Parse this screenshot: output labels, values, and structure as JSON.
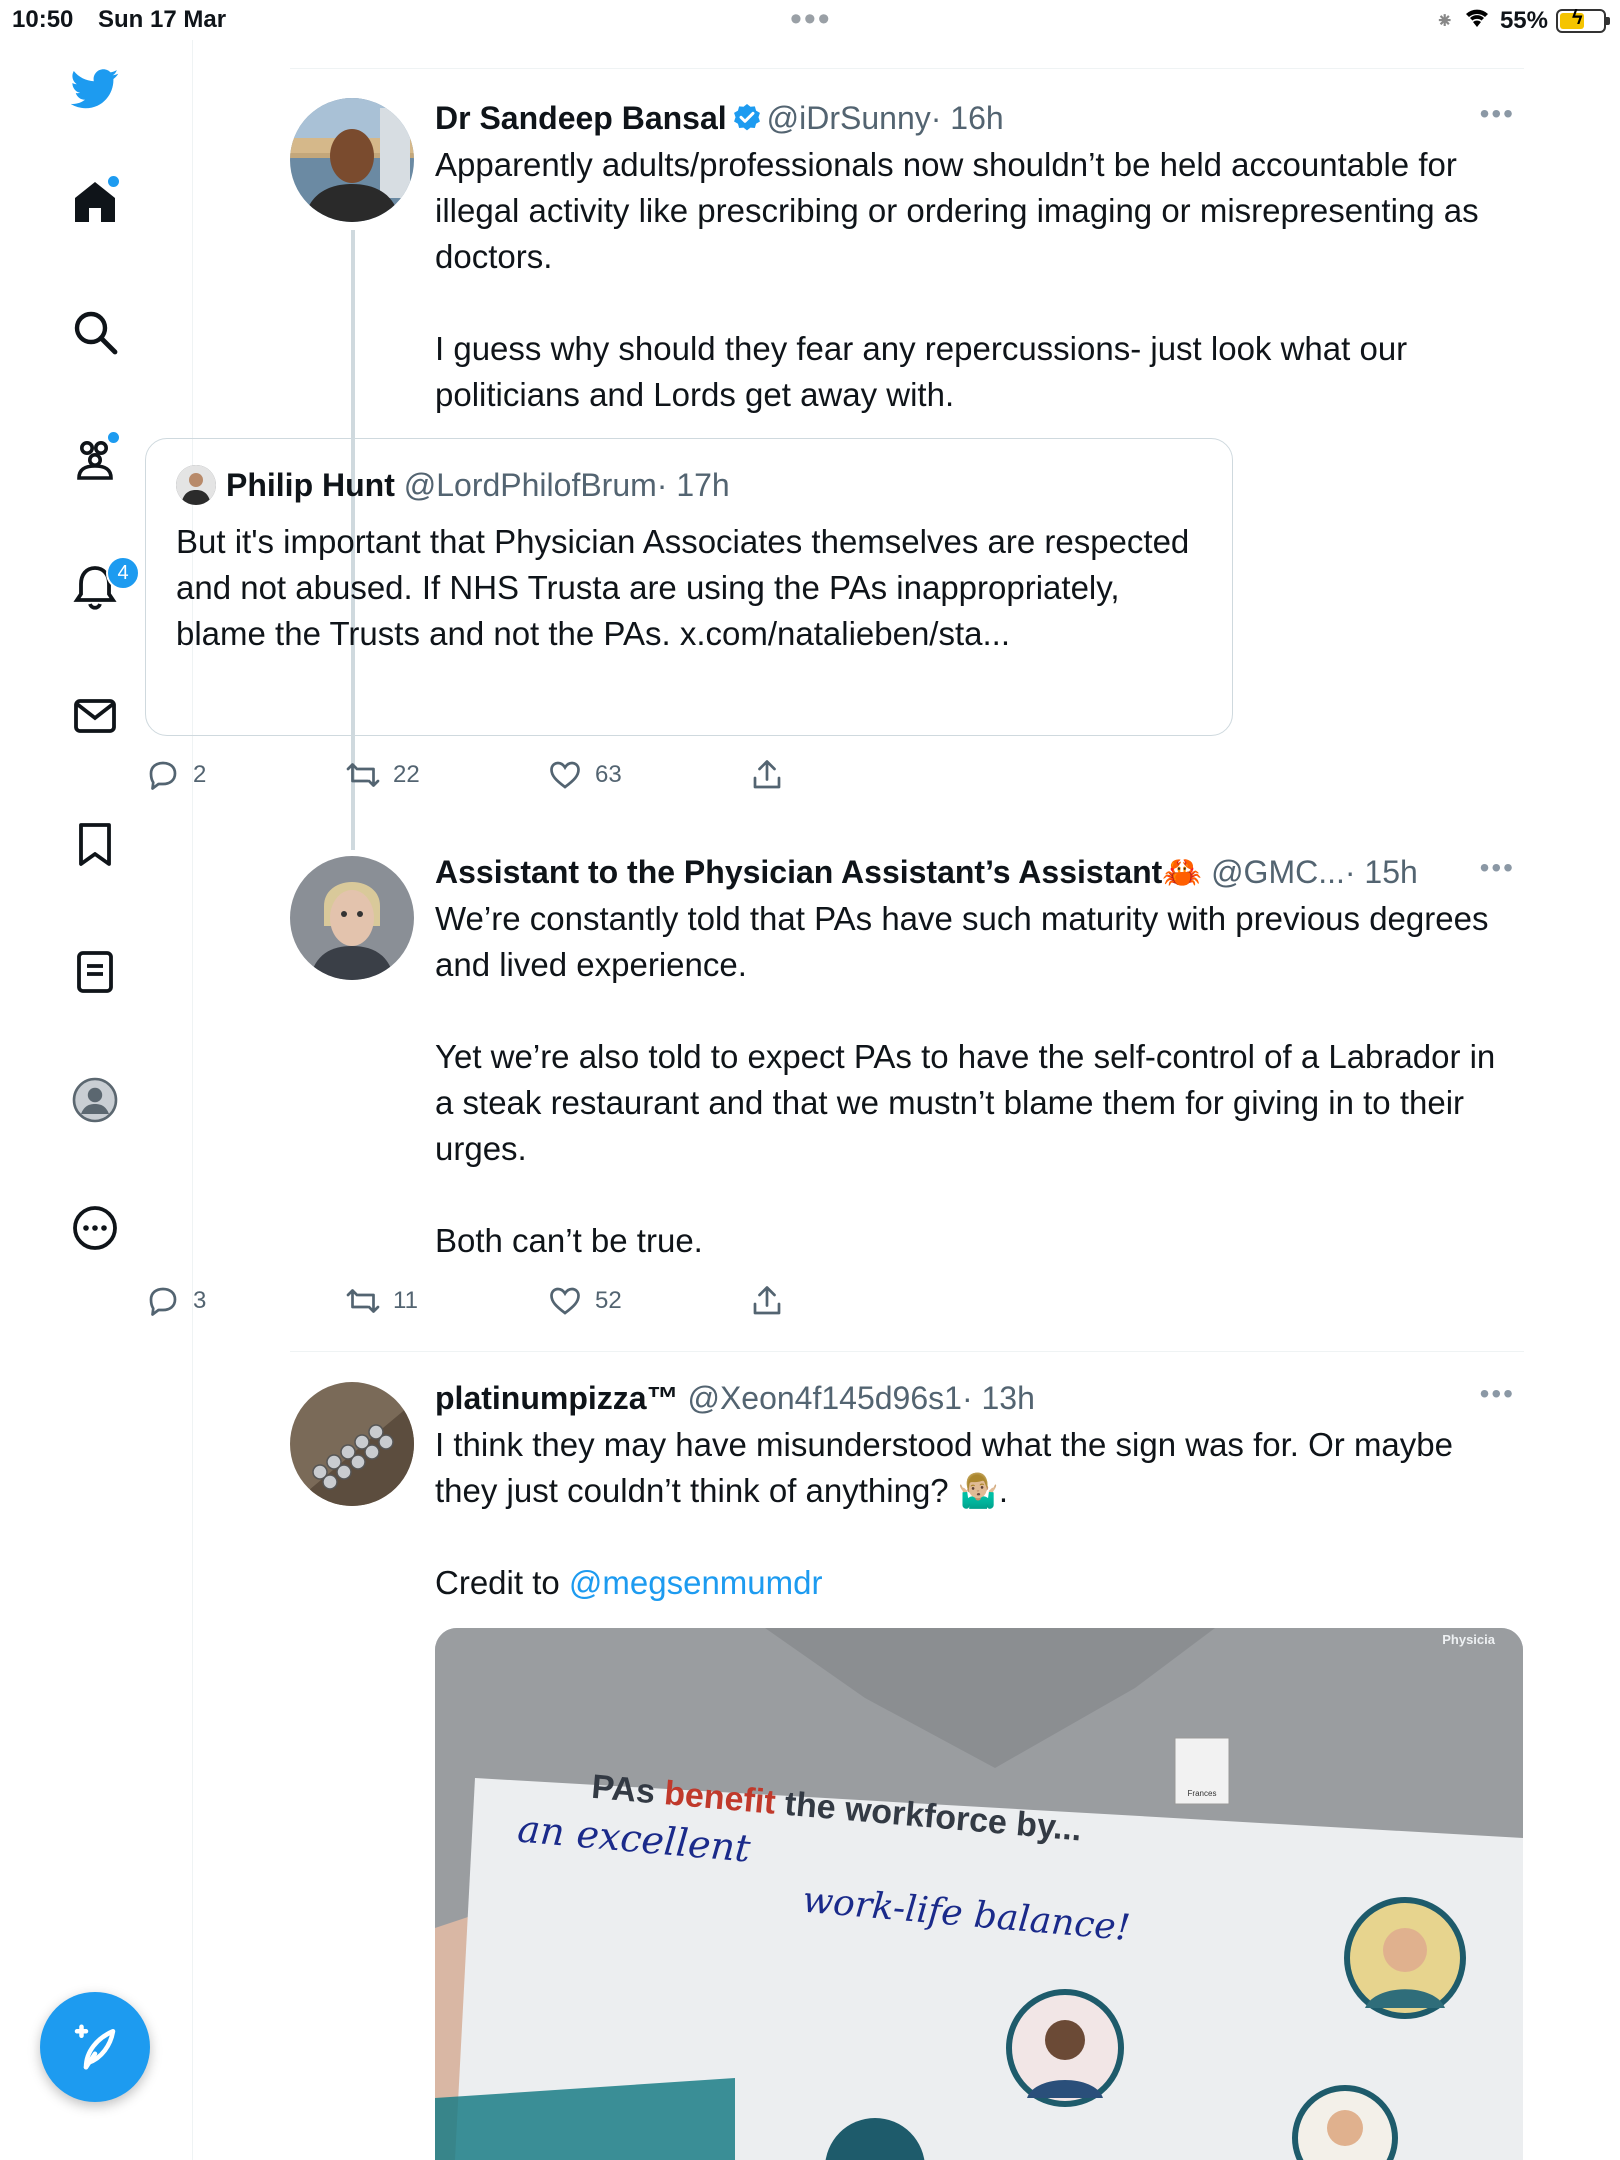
{
  "status_bar": {
    "time": "10:50",
    "date": "Sun 17 Mar",
    "battery": "55%"
  },
  "sidebar": {
    "notifications_count": "4",
    "items": [
      {
        "name": "twitter-logo-icon"
      },
      {
        "name": "home-icon"
      },
      {
        "name": "search-icon"
      },
      {
        "name": "communities-icon"
      },
      {
        "name": "notifications-icon"
      },
      {
        "name": "messages-icon"
      },
      {
        "name": "bookmarks-icon"
      },
      {
        "name": "lists-icon"
      },
      {
        "name": "profile-icon"
      },
      {
        "name": "more-icon"
      }
    ]
  },
  "tweets": [
    {
      "name": "Dr Sandeep Bansal",
      "handle": "@iDrSunny",
      "time": "· 16h",
      "text": "Apparently adults/professionals now shouldn’t be held accountable for illegal activity like prescribing or ordering imaging or misrepresenting as doctors.\n\nI guess why should they fear any repercussions- just look what our politicians and Lords get away with.",
      "quote": {
        "name": "Philip Hunt",
        "handle": "@LordPhilofBrum",
        "time": "· 17h",
        "text": "But it's important that Physician Associates themselves are respected and not abused. If NHS Trusta are using the PAs inappropriately, blame the Trusts and not the PAs. x.com/natalieben/sta..."
      },
      "replies": "2",
      "retweets": "22",
      "likes": "63"
    },
    {
      "name": "Assistant to the Physician Assistant’s Assistant🦀",
      "handle": "@GMC...",
      "time": "· 15h",
      "text": "We’re constantly told that PAs have such maturity with previous degrees and lived experience.\n\nYet we’re also told to expect PAs to have the self-control of a Labrador in a steak restaurant and that we mustn’t blame them for giving in to their urges.\n\nBoth can’t be true.",
      "replies": "3",
      "retweets": "11",
      "likes": "52"
    },
    {
      "name": "platinumpizza™",
      "handle": "@Xeon4f145d96s1",
      "time": "· 13h",
      "text": "I think they may have misunderstood what the sign was for. Or maybe they just couldn’t think of anything? 🤷🏼‍♂️.",
      "credit_prefix": "Credit to ",
      "credit_link": "@megsenmumdr",
      "image": {
        "sign_line1_a": "PAs ",
        "sign_line1_b": "benefit",
        "sign_line1_c": " the workforce by...",
        "handwriting_1": "an excellent",
        "handwriting_2": "work-life balance!",
        "badge_text": "Physicia",
        "card_text": "Frances"
      }
    }
  ],
  "colors": {
    "accent": "#1d9bf0",
    "text": "#0f1419",
    "muted": "#536471",
    "benefit": "#c0392b",
    "handwriting": "#1a2a8a"
  }
}
